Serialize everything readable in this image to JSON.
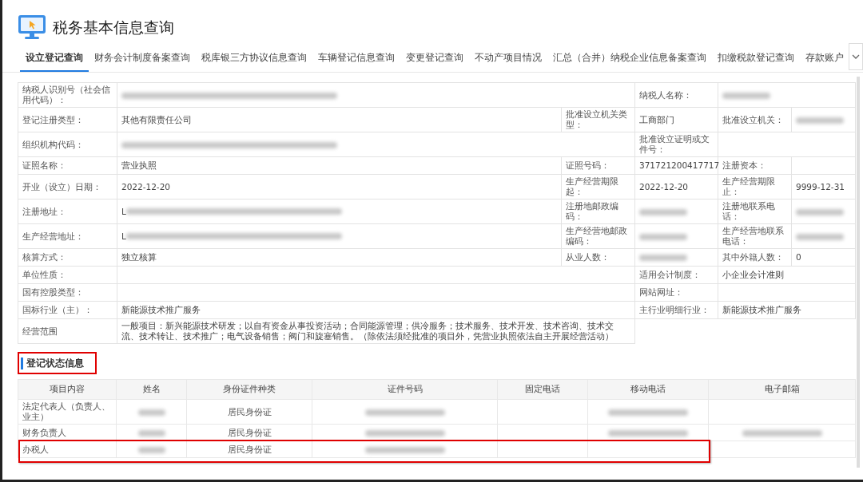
{
  "page": {
    "title": "税务基本信息查询"
  },
  "tabs": [
    {
      "label": "设立登记查询",
      "selected": true
    },
    {
      "label": "财务会计制度备案查询",
      "selected": false
    },
    {
      "label": "税库银三方协议信息查询",
      "selected": false
    },
    {
      "label": "车辆登记信息查询",
      "selected": false
    },
    {
      "label": "变更登记查询",
      "selected": false
    },
    {
      "label": "不动产项目情况",
      "selected": false
    },
    {
      "label": "汇总（合并）纳税企业信息备案查询",
      "selected": false
    },
    {
      "label": "扣缴税款登记查询",
      "selected": false
    },
    {
      "label": "存款账户",
      "selected": false
    }
  ],
  "info_table": {
    "rows": [
      {
        "cells": [
          {
            "kind": "label",
            "text": "纳税人识别号（社会信用代码）："
          },
          {
            "kind": "redacted",
            "colspan": 2
          },
          {
            "kind": "label",
            "text": "纳税人名称："
          },
          {
            "kind": "redacted",
            "colspan": 2
          }
        ]
      },
      {
        "cells": [
          {
            "kind": "label",
            "text": "登记注册类型："
          },
          {
            "kind": "value",
            "text": "其他有限责任公司"
          },
          {
            "kind": "label",
            "text": "批准设立机关类型："
          },
          {
            "kind": "value",
            "text": "工商部门"
          },
          {
            "kind": "label",
            "text": "批准设立机关："
          },
          {
            "kind": "redacted"
          }
        ]
      },
      {
        "cells": [
          {
            "kind": "label",
            "text": "组织机构代码："
          },
          {
            "kind": "redacted",
            "colspan": 2
          },
          {
            "kind": "label",
            "text": "批准设立证明或文件号："
          },
          {
            "kind": "empty",
            "colspan": 2
          }
        ]
      },
      {
        "cells": [
          {
            "kind": "label",
            "text": "证照名称："
          },
          {
            "kind": "value",
            "text": "营业执照"
          },
          {
            "kind": "label",
            "text": "证照号码："
          },
          {
            "kind": "value",
            "text": "371721200417717"
          },
          {
            "kind": "label",
            "text": "注册资本："
          },
          {
            "kind": "empty"
          }
        ]
      },
      {
        "cells": [
          {
            "kind": "label",
            "text": "开业（设立）日期："
          },
          {
            "kind": "value",
            "text": "2022-12-20"
          },
          {
            "kind": "label",
            "text": "生产经营期限起："
          },
          {
            "kind": "value",
            "text": "2022-12-20"
          },
          {
            "kind": "label",
            "text": "生产经营期限止："
          },
          {
            "kind": "value",
            "text": "9999-12-31"
          }
        ]
      },
      {
        "cells": [
          {
            "kind": "label",
            "text": "注册地址："
          },
          {
            "kind": "redacted",
            "text": "L"
          },
          {
            "kind": "label",
            "text": "注册地邮政编码："
          },
          {
            "kind": "redacted"
          },
          {
            "kind": "label",
            "text": "注册地联系电话："
          },
          {
            "kind": "redacted"
          }
        ]
      },
      {
        "cells": [
          {
            "kind": "label",
            "text": "生产经营地址："
          },
          {
            "kind": "redacted",
            "text": "L"
          },
          {
            "kind": "label",
            "text": "生产经营地邮政编码："
          },
          {
            "kind": "redacted"
          },
          {
            "kind": "label",
            "text": "生产经营地联系电话："
          },
          {
            "kind": "redacted"
          }
        ]
      },
      {
        "cells": [
          {
            "kind": "label",
            "text": "核算方式："
          },
          {
            "kind": "value",
            "text": "独立核算"
          },
          {
            "kind": "label",
            "text": "从业人数："
          },
          {
            "kind": "redacted"
          },
          {
            "kind": "label",
            "text": "其中外籍人数："
          },
          {
            "kind": "value",
            "text": "0"
          }
        ]
      },
      {
        "cells": [
          {
            "kind": "label",
            "text": "单位性质："
          },
          {
            "kind": "empty",
            "colspan": 2
          },
          {
            "kind": "label",
            "text": "适用会计制度："
          },
          {
            "kind": "value",
            "text": "小企业会计准则",
            "colspan": 2
          }
        ]
      },
      {
        "cells": [
          {
            "kind": "label",
            "text": "国有控股类型："
          },
          {
            "kind": "empty",
            "colspan": 2
          },
          {
            "kind": "label",
            "text": "网站网址："
          },
          {
            "kind": "empty",
            "colspan": 2
          }
        ]
      },
      {
        "cells": [
          {
            "kind": "label",
            "text": "国标行业（主）："
          },
          {
            "kind": "value",
            "text": "新能源技术推广服务",
            "colspan": 2
          },
          {
            "kind": "label",
            "text": "主行业明细行业："
          },
          {
            "kind": "value",
            "text": "新能源技术推广服务",
            "colspan": 2
          }
        ]
      },
      {
        "cells": [
          {
            "kind": "label",
            "text": "经营范围"
          },
          {
            "kind": "value",
            "text": "一般项目：新兴能源技术研发；以自有资金从事投资活动；合同能源管理；供冷服务；技术服务、技术开发、技术咨询、技术交流、技术转让、技术推广；电气设备销售；阀门和旋塞销售。（除依法须经批准的项目外，凭营业执照依法自主开展经营活动）",
            "colspan": 2
          }
        ]
      }
    ]
  },
  "section": {
    "title": "登记状态信息",
    "highlighted": true
  },
  "status_table": {
    "columns": [
      "项目内容",
      "姓名",
      "身份证件种类",
      "证件号码",
      "固定电话",
      "移动电话",
      "电子邮箱"
    ],
    "rows": [
      {
        "highlighted": false,
        "cells": [
          {
            "kind": "value",
            "text": "法定代表人（负责人、业主）"
          },
          {
            "kind": "redacted"
          },
          {
            "kind": "value",
            "text": "居民身份证"
          },
          {
            "kind": "redacted"
          },
          {
            "kind": "empty"
          },
          {
            "kind": "redacted"
          },
          {
            "kind": "empty"
          }
        ]
      },
      {
        "highlighted": false,
        "cells": [
          {
            "kind": "value",
            "text": "财务负责人"
          },
          {
            "kind": "redacted"
          },
          {
            "kind": "value",
            "text": "居民身份证"
          },
          {
            "kind": "redacted"
          },
          {
            "kind": "empty"
          },
          {
            "kind": "redacted"
          },
          {
            "kind": "redacted"
          }
        ]
      },
      {
        "highlighted": true,
        "cells": [
          {
            "kind": "value",
            "text": "办税人"
          },
          {
            "kind": "redacted"
          },
          {
            "kind": "value",
            "text": "居民身份证"
          },
          {
            "kind": "redacted"
          },
          {
            "kind": "empty"
          },
          {
            "kind": "empty"
          },
          {
            "kind": "empty"
          }
        ]
      }
    ]
  }
}
